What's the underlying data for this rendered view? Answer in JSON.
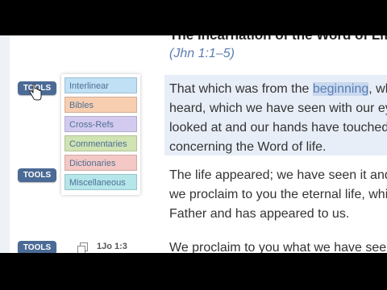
{
  "passage": {
    "heading": "The Incarnation of the Word of Life",
    "reference": "(Jhn 1:1–5)"
  },
  "tools_label": "TOOLS",
  "tools_menu": [
    {
      "label": "Interlinear",
      "color": "#bfe0f5",
      "text_color": "#4f6f94"
    },
    {
      "label": "Bibles",
      "color": "#f7ceb0",
      "text_color": "#4f6f94"
    },
    {
      "label": "Cross-Refs",
      "color": "#d3cbef",
      "text_color": "#4f6f94"
    },
    {
      "label": "Commentaries",
      "color": "#cfe3b3",
      "text_color": "#4f6f94"
    },
    {
      "label": "Dictionaries",
      "color": "#f4c8c4",
      "text_color": "#4f6f94"
    },
    {
      "label": "Miscellaneous",
      "color": "#b4e6ea",
      "text_color": "#4f6f94"
    }
  ],
  "verses": [
    {
      "lines": [
        [
          "That which was from the ",
          "beginning",
          ", wh"
        ],
        [
          "heard, which we have seen with our ey"
        ],
        [
          "looked at and our hands have touched"
        ],
        [
          "concerning the Word of life."
        ]
      ]
    },
    {
      "lines": [
        [
          "The life appeared; we have seen it and"
        ],
        [
          "we proclaim to you the eternal life, whi"
        ],
        [
          "Father and has appeared to us."
        ]
      ]
    },
    {
      "ref": "1Jo 1:3",
      "lines": [
        [
          "We proclaim to you what we have seen"
        ]
      ]
    }
  ]
}
